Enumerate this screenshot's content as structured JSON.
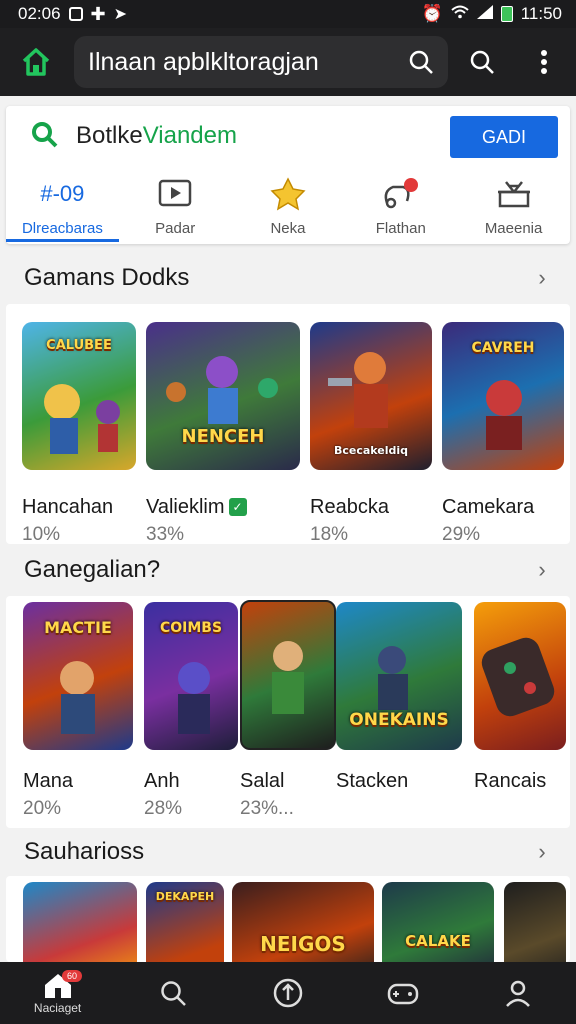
{
  "status_bar": {
    "time": "02:06",
    "clock": "11:50"
  },
  "search": {
    "placeholder": "Ilnaan apblkltoragjan"
  },
  "account": {
    "title_part1": "Botlke",
    "title_part2": "Viandem",
    "get_button": "GADI",
    "tabs": [
      {
        "icon": "#-09",
        "label": "Dlreacbaras",
        "active": true
      },
      {
        "icon": "video-icon",
        "label": "Padar"
      },
      {
        "icon": "trophy-icon",
        "label": "Neka"
      },
      {
        "icon": "gamepad-icon",
        "label": "Flathan"
      },
      {
        "icon": "gift-icon",
        "label": "Maeenia"
      }
    ]
  },
  "sections": [
    {
      "title": "Gamans Dodks",
      "games": [
        {
          "name": "Hancahan",
          "pct": "10%",
          "thumb_text": "CALUBEE"
        },
        {
          "name": "Valieklim",
          "pct": "33%",
          "thumb_text": "NENCEH",
          "verified": true
        },
        {
          "name": "Reabcka",
          "pct": "18%",
          "thumb_text": "Bcecakeldiq"
        },
        {
          "name": "Camekara",
          "pct": "29%",
          "thumb_text": "CAVREH"
        }
      ]
    },
    {
      "title": "Ganegalian?",
      "games": [
        {
          "name": "Mana",
          "pct": "20%",
          "thumb_text": "MACTIE"
        },
        {
          "name": "Anh",
          "pct": "28%",
          "thumb_text": "COIMBS"
        },
        {
          "name": "Salal",
          "pct": "23%...",
          "thumb_text": ""
        },
        {
          "name": "Stacken",
          "pct": "",
          "thumb_text": "ONEKAINS"
        },
        {
          "name": "Rancais",
          "pct": "",
          "thumb_text": ""
        }
      ]
    },
    {
      "title": "Sauharioss",
      "games": [
        {
          "name": "",
          "pct": "",
          "thumb_text": ""
        },
        {
          "name": "",
          "pct": "",
          "thumb_text": "DEKAPEH"
        },
        {
          "name": "",
          "pct": "",
          "thumb_text": "NEIGOS"
        },
        {
          "name": "",
          "pct": "",
          "thumb_text": "CALAKE"
        },
        {
          "name": "",
          "pct": "",
          "thumb_text": ""
        }
      ]
    }
  ],
  "bottom_nav": [
    {
      "label": "Naciaget",
      "badge": "60"
    },
    {
      "label": ""
    },
    {
      "label": ""
    },
    {
      "label": ""
    },
    {
      "label": ""
    }
  ],
  "colors": {
    "accent": "#1769e0",
    "brand_green": "#16a34a",
    "topbar": "#1f1f21"
  }
}
